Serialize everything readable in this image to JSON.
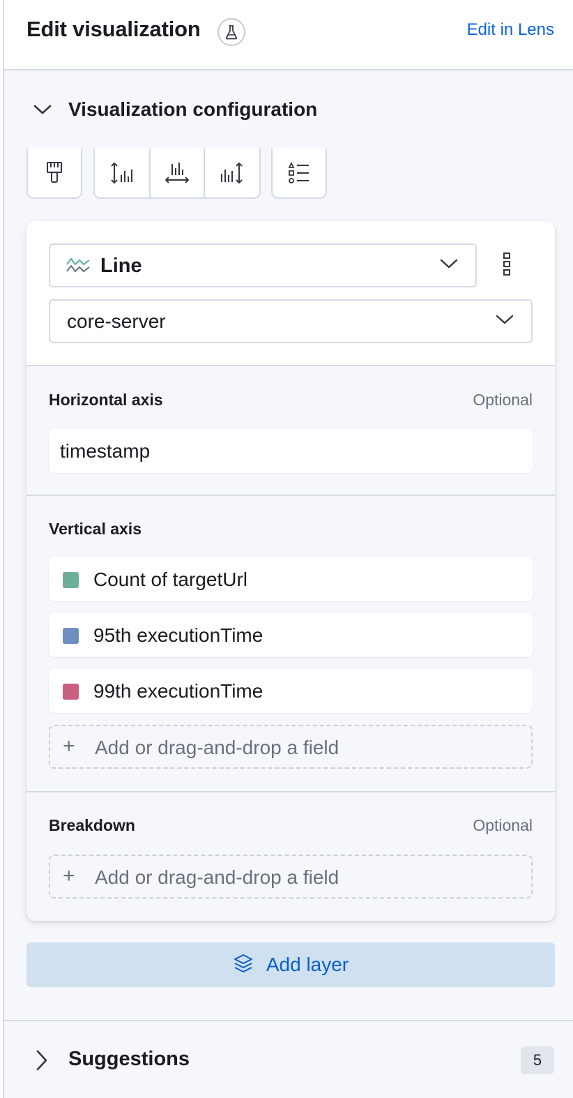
{
  "header": {
    "title": "Edit visualization",
    "lens_link": "Edit in Lens"
  },
  "config": {
    "title": "Visualization configuration",
    "toolbar_icons": [
      "paintbrush-icon",
      "left-axis-icon",
      "bottom-axis-icon",
      "right-axis-icon",
      "legend-icon"
    ]
  },
  "layer": {
    "chart_type": "Line",
    "index": "core-server",
    "horizontal_axis": {
      "label": "Horizontal axis",
      "optional": "Optional",
      "field": "timestamp"
    },
    "vertical_axis": {
      "label": "Vertical axis",
      "fields": [
        {
          "name": "Count of targetUrl",
          "color": "#6dae97"
        },
        {
          "name": "95th executionTime",
          "color": "#6d8fbd"
        },
        {
          "name": "99th executionTime",
          "color": "#c9607f"
        }
      ],
      "add_label": "Add or drag-and-drop a field"
    },
    "breakdown": {
      "label": "Breakdown",
      "optional": "Optional",
      "add_label": "Add or drag-and-drop a field"
    }
  },
  "add_layer": "Add layer",
  "suggestions": {
    "title": "Suggestions",
    "count": "5"
  }
}
